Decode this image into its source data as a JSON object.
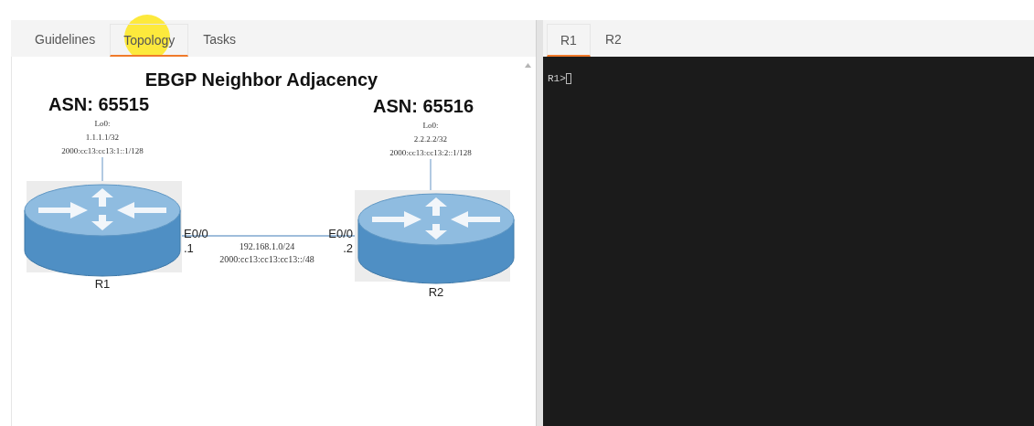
{
  "left_tabs": [
    {
      "label": "Guidelines",
      "selected": false
    },
    {
      "label": "Topology",
      "selected": true
    },
    {
      "label": "Tasks",
      "selected": false
    }
  ],
  "topology": {
    "title": "EBGP Neighbor Adjacency",
    "routers": [
      {
        "name": "R1",
        "asn": "ASN: 65515",
        "loopback": [
          "Lo0:",
          "1.1.1.1/32",
          "2000:cc13:cc13:1::1/128"
        ],
        "interface": "E0/0",
        "host": ".1"
      },
      {
        "name": "R2",
        "asn": "ASN: 65516",
        "loopback": [
          "Lo0:",
          "2.2.2.2/32",
          "2000:cc13:cc13:2::1/128"
        ],
        "interface": "E0/0",
        "host": ".2"
      }
    ],
    "link": [
      "192.168.1.0/24",
      "2000:cc13:cc13:cc13::/48"
    ]
  },
  "right_tabs": [
    {
      "label": "R1",
      "selected": true
    },
    {
      "label": "R2",
      "selected": false
    }
  ],
  "terminal": {
    "prompt": "R1>"
  }
}
